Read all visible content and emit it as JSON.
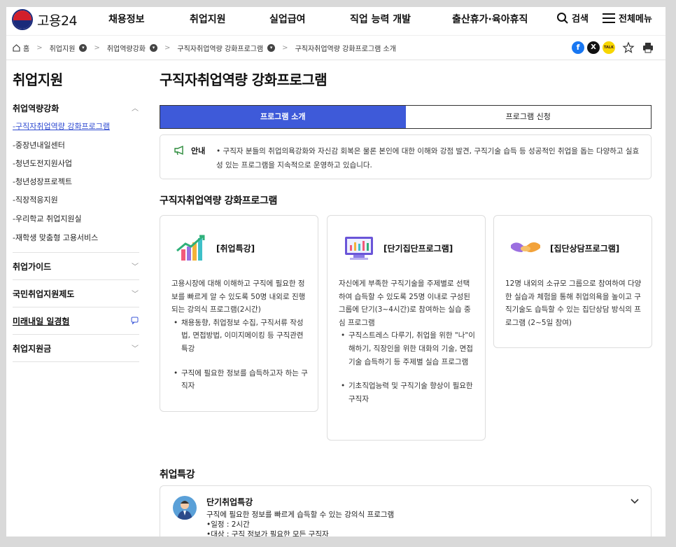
{
  "header": {
    "logo_text": "고용24",
    "nav": [
      "채용정보",
      "취업지원",
      "실업급여",
      "직업 능력 개발",
      "출산휴가·육아휴직"
    ],
    "search_label": "검색",
    "allmenu_label": "전체메뉴"
  },
  "breadcrumb": {
    "home": "홈",
    "items": [
      "취업지원",
      "취업역량강화",
      "구직자취업역량 강화프로그램",
      "구직자취업역량 강화프로그램 소개"
    ]
  },
  "share": {
    "facebook": "f",
    "x": "X",
    "kakao": "TALK"
  },
  "sidebar": {
    "title": "취업지원",
    "sections": [
      {
        "label": "취업역량강화",
        "items": [
          "구직자취업역량 강화프로그램",
          "중장년내일센터",
          "청년도전지원사업",
          "청년성장프로젝트",
          "직장적응지원",
          "우리학교 취업지원실",
          "재학생 맞춤형 고용서비스"
        ]
      },
      {
        "label": "취업가이드"
      },
      {
        "label": "국민취업지원제도"
      },
      {
        "label": "미래내일 일경험"
      },
      {
        "label": "취업지원금"
      }
    ]
  },
  "main": {
    "title": "구직자취업역량 강화프로그램",
    "tabs": [
      "프로그램 소개",
      "프로그램 신청"
    ],
    "notice": {
      "label": "안내",
      "text": "• 구직자 분들의 취업의욕강화와 자신감 회복은 물론 본인에 대한 이해와 강점 발견, 구직기술 습득 등 성공적인 취업을 돕는 다양하고 실효성 있는 프로그램을 지속적으로 운영하고 있습니다."
    },
    "programs_title": "구직자취업역량 강화프로그램",
    "cards": [
      {
        "title": "[취업특강]",
        "desc": "고용시장에 대해 이해하고 구직에 필요한 정보를 빠르게 알 수 있도록 50명 내외로 진행되는 강의식 프로그램(2시간)",
        "bullets": [
          "채용동향, 취업정보 수집, 구직서류 작성법, 면접방법, 이미지메이킹 등 구직관련 특강",
          "구직에 필요한 정보를 습득하고자 하는 구직자"
        ]
      },
      {
        "title": "[단기집단프로그램]",
        "desc": "자신에게 부족한 구직기술을 주제별로 선택하여 습득할 수 있도록 25명 이내로 구성된 그룹에 단기(3~4시간)로 참여하는 실습 중심 프로그램",
        "bullets": [
          "구직스트레스 다루기, 취업을 위한 \"나\"이해하기, 직장인을 위한 대화의 기술, 면접기술 습득하기 등 주제별 실습 프로그램",
          "기초직업능력 및 구직기술 향상이 필요한 구직자"
        ]
      },
      {
        "title": "[집단상담프로그램]",
        "desc": "12명 내외의 소규모 그룹으로 참여하여 다양한 실습과 체험을 통해 취업의욕을 높이고 구직기술도 습득할 수 있는 집단상담 방식의 프로그램 (2~5일 참여)",
        "bullets": []
      }
    ],
    "lecture_title": "취업특강",
    "accordion": {
      "title": "단기취업특강",
      "desc": "구직에 필요한 정보를 빠르게 습득할 수 있는 강의식 프로그램",
      "schedule": "•일정 : 2시간",
      "target": "•대상 : 구직 정보가 필요한 모든 구직자"
    }
  },
  "colors": {
    "primary": "#3e5ad9",
    "link": "#2f4bd1",
    "logo_red": "#d21f2b",
    "logo_blue": "#1a2a7a"
  }
}
